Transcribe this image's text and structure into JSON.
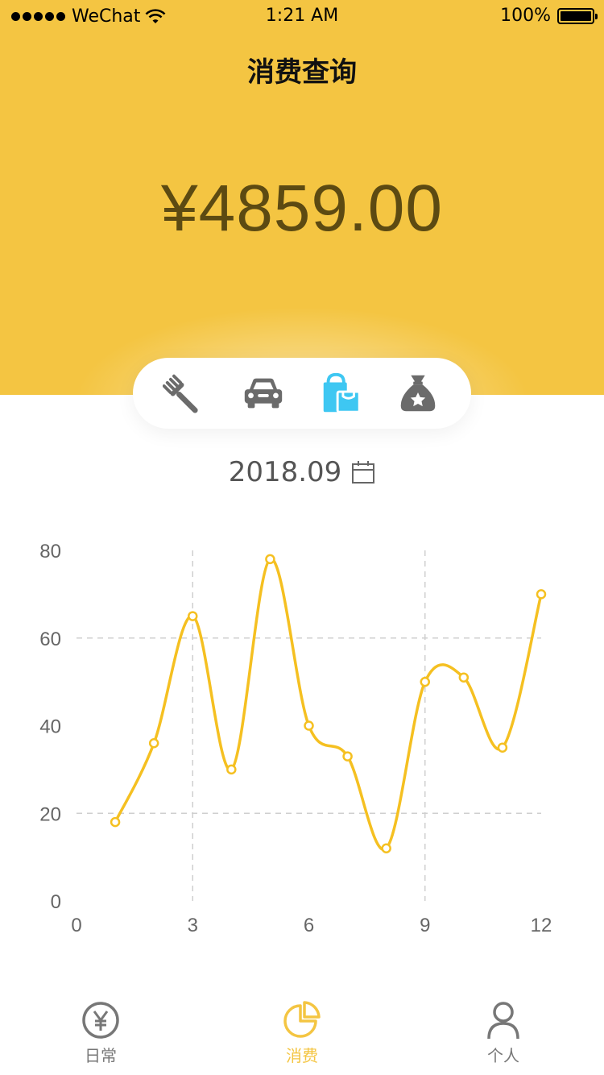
{
  "status_bar": {
    "carrier": "WeChat",
    "time": "1:21 AM",
    "battery": "100%"
  },
  "nav": {
    "title": "消费查询"
  },
  "summary": {
    "amount": "¥4859.00"
  },
  "categories": [
    {
      "icon": "fork-icon",
      "color": "#6b6b6b"
    },
    {
      "icon": "car-icon",
      "color": "#6b6b6b"
    },
    {
      "icon": "shopping-bag-icon",
      "color": "#3ec7f2",
      "active": true
    },
    {
      "icon": "money-bag-icon",
      "color": "#6b6b6b"
    }
  ],
  "month": {
    "label": "2018.09",
    "icon": "calendar-icon"
  },
  "colors": {
    "accent": "#f4c542",
    "line": "#f5c021",
    "amount_text": "#5c4a12"
  },
  "chart_data": {
    "type": "line",
    "x": [
      1,
      2,
      3,
      4,
      5,
      6,
      7,
      8,
      9,
      10,
      11,
      12
    ],
    "series": [
      {
        "values": [
          18,
          36,
          65,
          30,
          78,
          40,
          33,
          12,
          50,
          51,
          35,
          70
        ]
      }
    ],
    "xticks": [
      "0",
      "3",
      "6",
      "9",
      "12"
    ],
    "yticks": [
      "0",
      "20",
      "40",
      "60",
      "80"
    ],
    "xlim": [
      0,
      12
    ],
    "ylim": [
      0,
      80
    ],
    "grid": "dashed",
    "title": "",
    "xlabel": "",
    "ylabel": ""
  },
  "tabbar": {
    "tabs": [
      {
        "label": "日常",
        "icon": "yen-icon"
      },
      {
        "label": "消费",
        "icon": "pie-chart-icon",
        "active": true
      },
      {
        "label": "个人",
        "icon": "person-icon"
      }
    ]
  }
}
